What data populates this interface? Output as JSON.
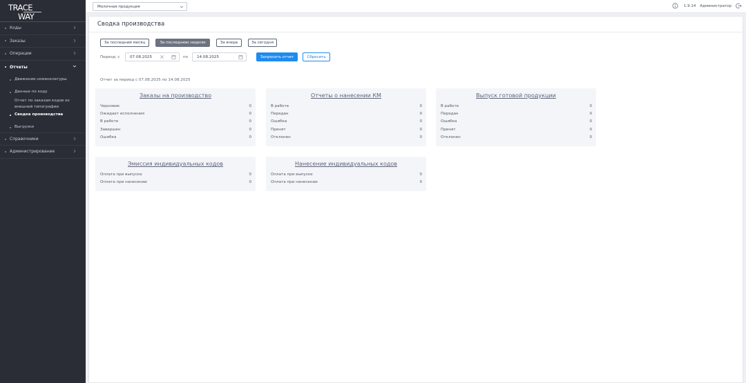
{
  "logo": {
    "line1": "TRACE",
    "line2": "WAY"
  },
  "sidebar": {
    "items": [
      {
        "label": "Коды"
      },
      {
        "label": "Заказы"
      },
      {
        "label": "Операции"
      },
      {
        "label": "Отчеты"
      }
    ],
    "sub_items": [
      {
        "label": "Движение номенклатуры"
      },
      {
        "label": "Данные по коду"
      },
      {
        "label": "Отчет по заказам кодов из внешней типографии"
      },
      {
        "label": "Сводка производства"
      },
      {
        "label": "Выгрузки"
      }
    ],
    "bottom_items": [
      {
        "label": "Справочники"
      },
      {
        "label": "Администрирование"
      }
    ]
  },
  "topbar": {
    "product_select": "Молочная продукция",
    "version": "1.9.14",
    "user": "Администратор"
  },
  "page": {
    "title": "Сводка производства",
    "range_buttons": [
      "За последний месяц",
      "За последнюю неделю",
      "За вчера",
      "За сегодня"
    ],
    "period_label": "Период: с",
    "to_label": "по",
    "date_from": "07.08.2025",
    "date_to": "14.08.2025",
    "request_button": "Запросить отчет",
    "reset_button": "Сбросить",
    "report_info": "Отчет за период с 07.08.2025 по 14.08.2025"
  },
  "panels": [
    {
      "title": "Заказы на производство",
      "rows": [
        {
          "label": "Черновик",
          "value": "0"
        },
        {
          "label": "Ожидает исполнения",
          "value": "0"
        },
        {
          "label": "В работе",
          "value": "0"
        },
        {
          "label": "Завершен",
          "value": "0"
        },
        {
          "label": "Ошибка",
          "value": "0"
        }
      ]
    },
    {
      "title": "Отчеты о нанесении КМ",
      "rows": [
        {
          "label": "В работе",
          "value": "0"
        },
        {
          "label": "Передан",
          "value": "0"
        },
        {
          "label": "Ошибка",
          "value": "0"
        },
        {
          "label": "Принят",
          "value": "0"
        },
        {
          "label": "Отклонен",
          "value": "0"
        }
      ]
    },
    {
      "title": "Выпуск готовой продукции",
      "rows": [
        {
          "label": "В работе",
          "value": "0"
        },
        {
          "label": "Передан",
          "value": "0"
        },
        {
          "label": "Ошибка",
          "value": "0"
        },
        {
          "label": "Принят",
          "value": "0"
        },
        {
          "label": "Отклонен",
          "value": "0"
        }
      ]
    },
    {
      "title": "Эмиссия индивидуальных кодов",
      "rows": [
        {
          "label": "Оплата при выпуске",
          "value": "0"
        },
        {
          "label": "Оплата при нанесении",
          "value": "0"
        }
      ]
    },
    {
      "title": "Нанесение индивидуальных кодов",
      "rows": [
        {
          "label": "Оплата при выпуске",
          "value": "0"
        },
        {
          "label": "Оплата при нанесении",
          "value": "0"
        }
      ]
    }
  ]
}
